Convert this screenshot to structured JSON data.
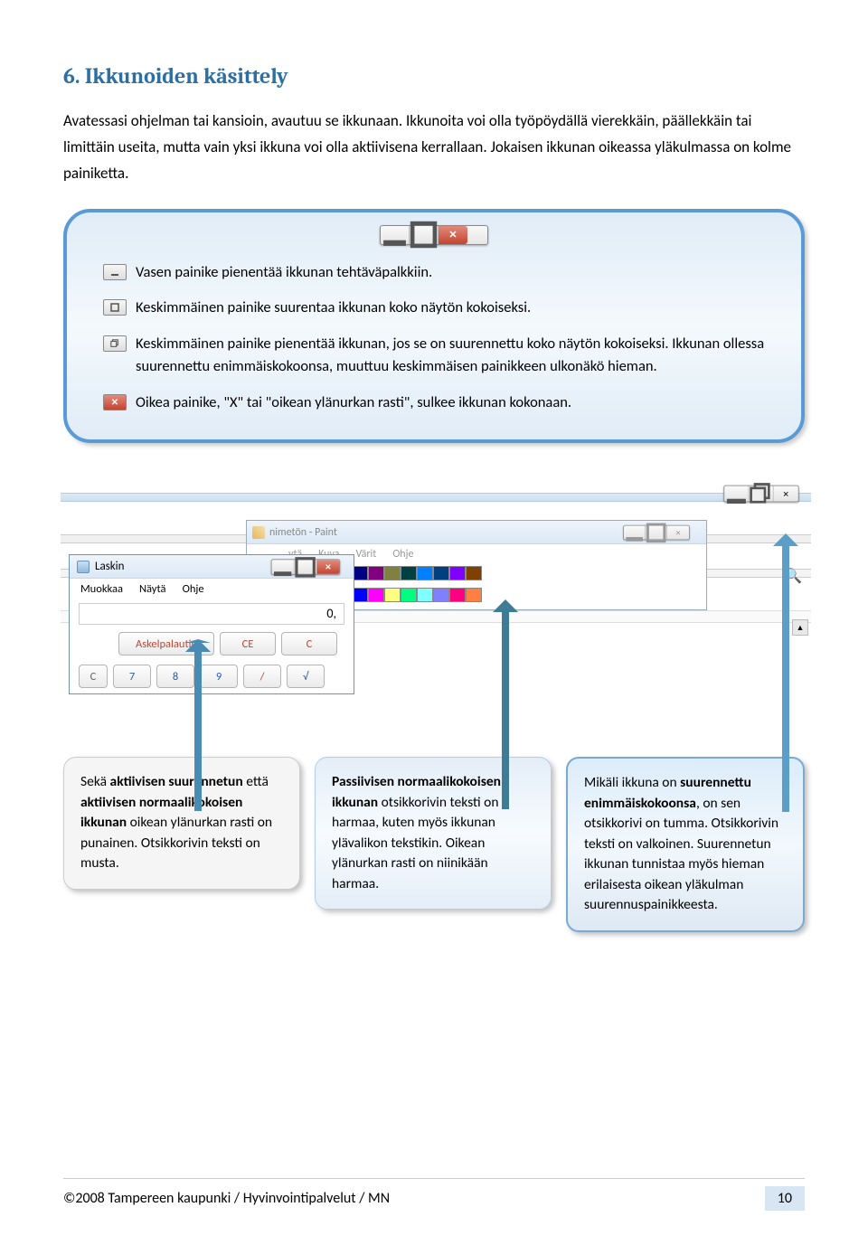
{
  "heading": "6. Ikkunoiden käsittely",
  "intro": "Avatessasi ohjelman tai kansioin, avautuu se ikkunaan. Ikkunoita voi olla työpöydällä vierekkäin, päällekkäin tai limittäin useita, mutta vain yksi ikkuna voi olla aktiivisena kerrallaan. Jokaisen ikkunan oikeassa yläkulmassa on kolme painiketta.",
  "callout": {
    "minimize": "Vasen painike pienentää ikkunan tehtäväpalkkiin.",
    "maximize": "Keskimmäinen painike suurentaa ikkunan koko näytön kokoiseksi.",
    "restore": "Keskimmäinen painike pienentää ikkunan, jos se on suurennettu koko näytön kokoiseksi. Ikkunan ollessa suurennettu enimmäiskokoonsa, muuttuu keskimmäisen painikkeen ulkonäkö hieman.",
    "close": "Oikea painike, \"X\" tai \"oikean ylänurkan rasti\", sulkee ikkunan kokonaan."
  },
  "collage": {
    "paint": {
      "title": "nimetön - Paint",
      "menus": [
        "ytä",
        "Kuva",
        "Värit",
        "Ohje"
      ],
      "palette": [
        "#000",
        "#808080",
        "#800000",
        "#808000",
        "#008000",
        "#008080",
        "#000080",
        "#800080",
        "#808040",
        "#004040",
        "#0080ff",
        "#004080",
        "#8000ff",
        "#804000",
        "#fff",
        "#c0c0c0",
        "#ff0000",
        "#ffff00",
        "#00ff00",
        "#00ffff",
        "#0000ff",
        "#ff00ff",
        "#ffff80",
        "#00ff80",
        "#80ffff",
        "#8080ff",
        "#ff0080",
        "#ff8040"
      ]
    },
    "calc": {
      "title": "Laskin",
      "menus": [
        "Muokkaa",
        "Näytä",
        "Ohje"
      ],
      "display": "0,",
      "row1": [
        "Askelpalautin",
        "CE",
        "C"
      ],
      "row2": [
        "C",
        "7",
        "8",
        "9",
        "/",
        "√"
      ]
    }
  },
  "notes": {
    "n1_pre": "Sekä ",
    "n1_b1": "aktiivisen suurennetun",
    "n1_mid1": " että ",
    "n1_b2": "aktiivisen normaalikokoisen ikkunan",
    "n1_post": " oikean ylänurkan rasti on punainen. Otsikkorivin teksti on musta.",
    "n2_b1": "Passiivisen normaalikokoisen ikkunan",
    "n2_post": " otsikkorivin teksti on harmaa, kuten myös ikkunan ylävalikon tekstikin. Oikean ylänurkan rasti on niinikään harmaa.",
    "n3_pre": "Mikäli ikkuna on ",
    "n3_b1": "suurennettu enimmäiskokoonsa",
    "n3_post": ", on sen otsikkorivi on tumma. Otsikkorivin teksti on valkoinen. Suurennetun ikkunan tunnistaa myös hieman erilaisesta oikean yläkulman suurennuspainikkeesta."
  },
  "footer": {
    "copyright": "©2008 Tampereen kaupunki / Hyvinvointipalvelut / MN",
    "page": "10"
  }
}
